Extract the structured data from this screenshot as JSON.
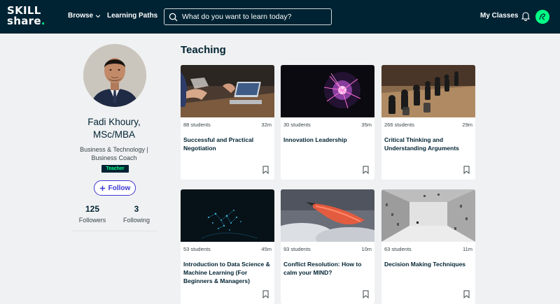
{
  "nav": {
    "logo_line1": "SKILL",
    "logo_line2": "share",
    "logo_dot": ".",
    "browse_label": "Browse",
    "learning_paths_label": "Learning Paths",
    "search_placeholder": "What do you want to learn today?",
    "my_classes_label": "My Classes"
  },
  "profile": {
    "name_line1": "Fadi Khoury,",
    "name_line2": "MSc/MBA",
    "role_line1": "Business & Technology |",
    "role_line2": "Business Coach",
    "badge": "Teacher",
    "follow_label": "Follow",
    "followers_count": "125",
    "followers_label": "Followers",
    "following_count": "3",
    "following_label": "Following"
  },
  "teaching": {
    "title": "Teaching",
    "cards": [
      {
        "students": "88 students",
        "duration": "32m",
        "title": "Successful and Practical Negotiation"
      },
      {
        "students": "30 students",
        "duration": "35m",
        "title": "Innovation Leadership"
      },
      {
        "students": "266 students",
        "duration": "29m",
        "title": "Critical Thinking and Understanding Arguments"
      },
      {
        "students": "53 students",
        "duration": "45m",
        "title": "Introduction to Data Science & Machine Learning (For Beginners & Managers)"
      },
      {
        "students": "93 students",
        "duration": "10m",
        "title": "Conflict Resolution: How to calm your MIND?"
      },
      {
        "students": "63 students",
        "duration": "11m",
        "title": "Decision Making Techniques"
      }
    ]
  },
  "colors": {
    "nav_bg": "#002333",
    "accent_green": "#00ff84",
    "follow_blue": "#3c39d1",
    "page_bg": "#f0f1f2"
  },
  "icons": [
    "chevron-down-icon",
    "search-icon",
    "bell-icon",
    "plus-icon",
    "bookmark-icon"
  ]
}
